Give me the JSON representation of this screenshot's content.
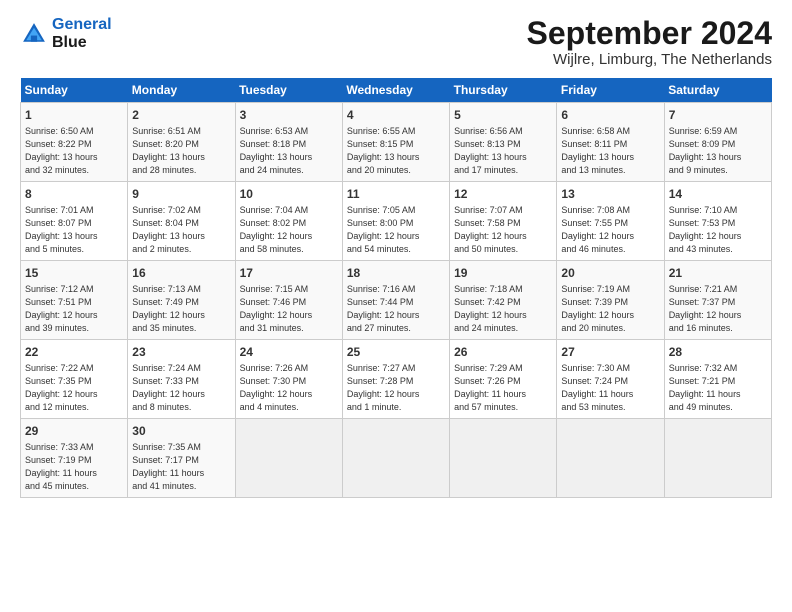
{
  "logo": {
    "line1": "General",
    "line2": "Blue"
  },
  "title": "September 2024",
  "subtitle": "Wijlre, Limburg, The Netherlands",
  "days_header": [
    "Sunday",
    "Monday",
    "Tuesday",
    "Wednesday",
    "Thursday",
    "Friday",
    "Saturday"
  ],
  "weeks": [
    [
      {
        "num": "1",
        "info": "Sunrise: 6:50 AM\nSunset: 8:22 PM\nDaylight: 13 hours\nand 32 minutes."
      },
      {
        "num": "2",
        "info": "Sunrise: 6:51 AM\nSunset: 8:20 PM\nDaylight: 13 hours\nand 28 minutes."
      },
      {
        "num": "3",
        "info": "Sunrise: 6:53 AM\nSunset: 8:18 PM\nDaylight: 13 hours\nand 24 minutes."
      },
      {
        "num": "4",
        "info": "Sunrise: 6:55 AM\nSunset: 8:15 PM\nDaylight: 13 hours\nand 20 minutes."
      },
      {
        "num": "5",
        "info": "Sunrise: 6:56 AM\nSunset: 8:13 PM\nDaylight: 13 hours\nand 17 minutes."
      },
      {
        "num": "6",
        "info": "Sunrise: 6:58 AM\nSunset: 8:11 PM\nDaylight: 13 hours\nand 13 minutes."
      },
      {
        "num": "7",
        "info": "Sunrise: 6:59 AM\nSunset: 8:09 PM\nDaylight: 13 hours\nand 9 minutes."
      }
    ],
    [
      {
        "num": "8",
        "info": "Sunrise: 7:01 AM\nSunset: 8:07 PM\nDaylight: 13 hours\nand 5 minutes."
      },
      {
        "num": "9",
        "info": "Sunrise: 7:02 AM\nSunset: 8:04 PM\nDaylight: 13 hours\nand 2 minutes."
      },
      {
        "num": "10",
        "info": "Sunrise: 7:04 AM\nSunset: 8:02 PM\nDaylight: 12 hours\nand 58 minutes."
      },
      {
        "num": "11",
        "info": "Sunrise: 7:05 AM\nSunset: 8:00 PM\nDaylight: 12 hours\nand 54 minutes."
      },
      {
        "num": "12",
        "info": "Sunrise: 7:07 AM\nSunset: 7:58 PM\nDaylight: 12 hours\nand 50 minutes."
      },
      {
        "num": "13",
        "info": "Sunrise: 7:08 AM\nSunset: 7:55 PM\nDaylight: 12 hours\nand 46 minutes."
      },
      {
        "num": "14",
        "info": "Sunrise: 7:10 AM\nSunset: 7:53 PM\nDaylight: 12 hours\nand 43 minutes."
      }
    ],
    [
      {
        "num": "15",
        "info": "Sunrise: 7:12 AM\nSunset: 7:51 PM\nDaylight: 12 hours\nand 39 minutes."
      },
      {
        "num": "16",
        "info": "Sunrise: 7:13 AM\nSunset: 7:49 PM\nDaylight: 12 hours\nand 35 minutes."
      },
      {
        "num": "17",
        "info": "Sunrise: 7:15 AM\nSunset: 7:46 PM\nDaylight: 12 hours\nand 31 minutes."
      },
      {
        "num": "18",
        "info": "Sunrise: 7:16 AM\nSunset: 7:44 PM\nDaylight: 12 hours\nand 27 minutes."
      },
      {
        "num": "19",
        "info": "Sunrise: 7:18 AM\nSunset: 7:42 PM\nDaylight: 12 hours\nand 24 minutes."
      },
      {
        "num": "20",
        "info": "Sunrise: 7:19 AM\nSunset: 7:39 PM\nDaylight: 12 hours\nand 20 minutes."
      },
      {
        "num": "21",
        "info": "Sunrise: 7:21 AM\nSunset: 7:37 PM\nDaylight: 12 hours\nand 16 minutes."
      }
    ],
    [
      {
        "num": "22",
        "info": "Sunrise: 7:22 AM\nSunset: 7:35 PM\nDaylight: 12 hours\nand 12 minutes."
      },
      {
        "num": "23",
        "info": "Sunrise: 7:24 AM\nSunset: 7:33 PM\nDaylight: 12 hours\nand 8 minutes."
      },
      {
        "num": "24",
        "info": "Sunrise: 7:26 AM\nSunset: 7:30 PM\nDaylight: 12 hours\nand 4 minutes."
      },
      {
        "num": "25",
        "info": "Sunrise: 7:27 AM\nSunset: 7:28 PM\nDaylight: 12 hours\nand 1 minute."
      },
      {
        "num": "26",
        "info": "Sunrise: 7:29 AM\nSunset: 7:26 PM\nDaylight: 11 hours\nand 57 minutes."
      },
      {
        "num": "27",
        "info": "Sunrise: 7:30 AM\nSunset: 7:24 PM\nDaylight: 11 hours\nand 53 minutes."
      },
      {
        "num": "28",
        "info": "Sunrise: 7:32 AM\nSunset: 7:21 PM\nDaylight: 11 hours\nand 49 minutes."
      }
    ],
    [
      {
        "num": "29",
        "info": "Sunrise: 7:33 AM\nSunset: 7:19 PM\nDaylight: 11 hours\nand 45 minutes."
      },
      {
        "num": "30",
        "info": "Sunrise: 7:35 AM\nSunset: 7:17 PM\nDaylight: 11 hours\nand 41 minutes."
      },
      {
        "num": "",
        "info": ""
      },
      {
        "num": "",
        "info": ""
      },
      {
        "num": "",
        "info": ""
      },
      {
        "num": "",
        "info": ""
      },
      {
        "num": "",
        "info": ""
      }
    ]
  ]
}
